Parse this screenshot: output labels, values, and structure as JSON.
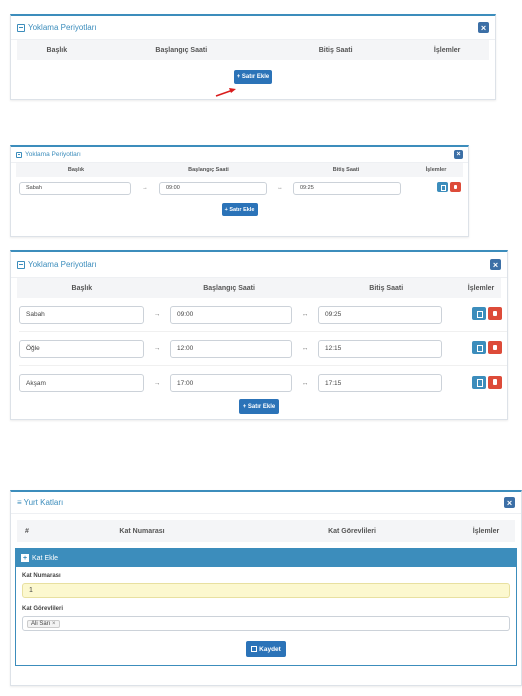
{
  "period_panel": {
    "title": "Yoklama Periyotları",
    "close": "×"
  },
  "headers": {
    "title": "Başlık",
    "start": "Başlangıç Saati",
    "end": "Bitiş Saati",
    "actions": "İşlemler"
  },
  "add_row_label": "Satır Ekle",
  "arrow": "→",
  "arrow2": "↔",
  "rows_b": [
    {
      "title": "Sabah",
      "start": "09:00",
      "end": "09:25"
    }
  ],
  "rows_c": [
    {
      "title": "Sabah",
      "start": "09:00",
      "end": "09:25"
    },
    {
      "title": "Öğle",
      "start": "12:00",
      "end": "12:15"
    },
    {
      "title": "Akşam",
      "start": "17:00",
      "end": "17:15"
    }
  ],
  "floor_panel": {
    "title": "Yurt Katları",
    "close": "×",
    "headers": {
      "num": "#",
      "floor": "Kat Numarası",
      "staff": "Kat Görevlileri",
      "actions": "İşlemler"
    },
    "form": {
      "title": "Kat Ekle",
      "floor_label": "Kat Numarası",
      "floor_value": "1",
      "staff_label": "Kat Görevlileri",
      "staff_tag": "Ali Sarı",
      "tag_x": "×",
      "save": "Kaydet"
    }
  }
}
